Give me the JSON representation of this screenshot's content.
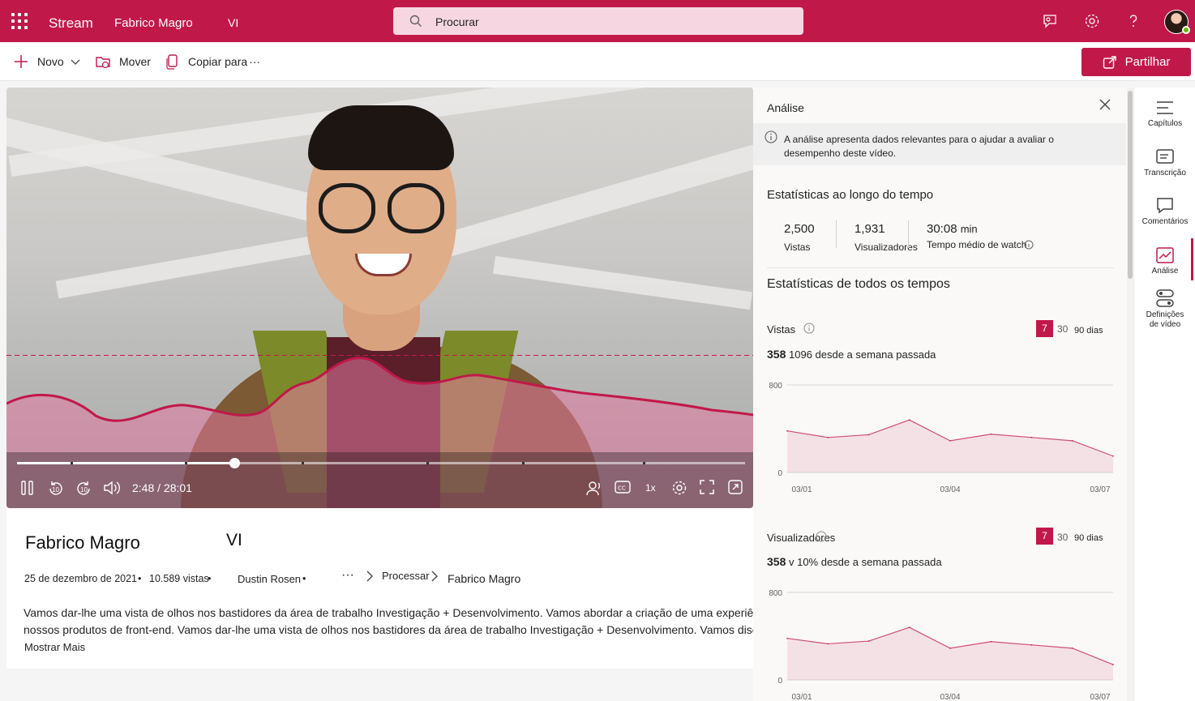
{
  "topbar": {
    "app_name": "Stream",
    "breadcrumb": [
      "Fabrico Magro",
      "VI"
    ],
    "search_placeholder": "Procurar",
    "accent_color": "#c1184a"
  },
  "commands": {
    "new_label": "Novo",
    "move_label": "Mover",
    "copy_label": "Copiar para",
    "more_label": "···",
    "share_label": "Partilhar"
  },
  "player": {
    "time": "2:48 / 28:01",
    "speed": "1x",
    "progress_percent": 29.8,
    "skip_back": "10",
    "skip_forward": "10"
  },
  "video_info": {
    "title": "Fabrico Magro",
    "title_suffix": "VI",
    "date": "25 de dezembro de 2021",
    "views": "10.589 vistas",
    "owner": "Dustin Rosen",
    "path_more": "···",
    "path_1": "Processar",
    "path_2": "Fabrico Magro",
    "description": "Vamos dar-lhe uma vista de olhos nos bastidores da área de trabalho Investigação + Desenvolvimento. Vamos abordar a criação de uma experiência unificada para os nossos produtos de front-end. Vamos dar-lhe uma vista de olhos nos bastidores da área de trabalho Investigação + Desenvolvimento. Vamos discutir v",
    "show_more": "Mostrar Mais"
  },
  "analytics": {
    "title": "Análise",
    "note": "A análise apresenta dados relevantes para o ajudar a avaliar o desempenho deste vídeo.",
    "over_time_title": "Estatísticas ao longo do tempo",
    "stats": [
      {
        "value": "2,500",
        "unit": "",
        "label": "Vistas"
      },
      {
        "value": "1,931",
        "unit": "",
        "label": "Visualizadores"
      },
      {
        "value": "30:08",
        "unit": "min",
        "label": "Tempo médio de watch"
      }
    ],
    "all_time_title": "Estatísticas de todos os tempos",
    "views_block": {
      "label": "Vistas",
      "ranges": [
        "7",
        "30",
        "90 dias"
      ],
      "selected": "7",
      "big_value": "358",
      "delta": "1096 desde a semana passada"
    },
    "viewers_block": {
      "label": "Visualizadores",
      "ranges": [
        "7",
        "30",
        "90 dias"
      ],
      "selected": "7",
      "big_value": "358",
      "delta": "v 10% desde a semana passada"
    }
  },
  "chart_data": [
    {
      "type": "area",
      "title": "Vistas",
      "ylim": [
        0,
        800
      ],
      "yticks": [
        "800",
        "0"
      ],
      "xticks": [
        "03/01",
        "03/04",
        "03/07"
      ],
      "values": [
        380,
        320,
        345,
        480,
        290,
        350,
        320,
        290,
        150
      ],
      "color": "#c1184a"
    },
    {
      "type": "area",
      "title": "Visualizadores",
      "ylim": [
        0,
        800
      ],
      "yticks": [
        "800",
        "0"
      ],
      "xticks": [
        "03/01",
        "03/04",
        "03/07"
      ],
      "values": [
        380,
        330,
        355,
        480,
        290,
        350,
        320,
        290,
        140
      ],
      "color": "#c1184a"
    }
  ],
  "rail": {
    "items": [
      "Capítulos",
      "Transcrição",
      "Comentários",
      "Análise",
      "Definições de vídeo"
    ]
  }
}
